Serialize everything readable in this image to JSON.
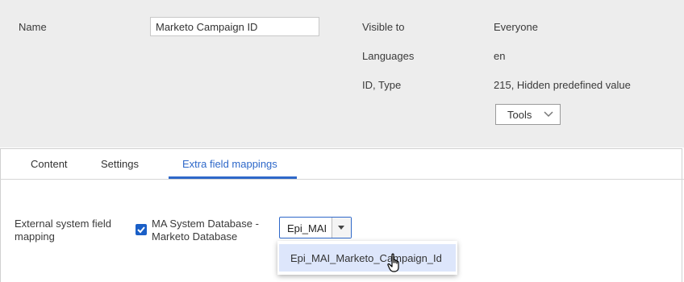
{
  "properties": {
    "name_label": "Name",
    "name_value": "Marketo Campaign ID",
    "visible_to_label": "Visible to",
    "visible_to_value": "Everyone",
    "languages_label": "Languages",
    "languages_value": "en",
    "id_type_label": "ID, Type",
    "id_type_value": "215, Hidden predefined value",
    "tools_label": "Tools"
  },
  "tabs": [
    {
      "label": "Content",
      "active": false
    },
    {
      "label": "Settings",
      "active": false
    },
    {
      "label": "Extra field mappings",
      "active": true
    }
  ],
  "mapping": {
    "label_line1": "External system field",
    "label_line2": "mapping",
    "checkbox_checked": true,
    "checkbox_label_line1": "MA System Database -",
    "checkbox_label_line2": "Marketo Database",
    "select_value": "Epi_MAI",
    "dropdown_options": [
      "Epi_MAI_Marketo_Campaign_Id"
    ]
  },
  "colors": {
    "accent": "#2e68c9",
    "checkbox": "#1a5fc7",
    "option_highlight": "#dde6fb",
    "panel_bg": "#ededed"
  }
}
